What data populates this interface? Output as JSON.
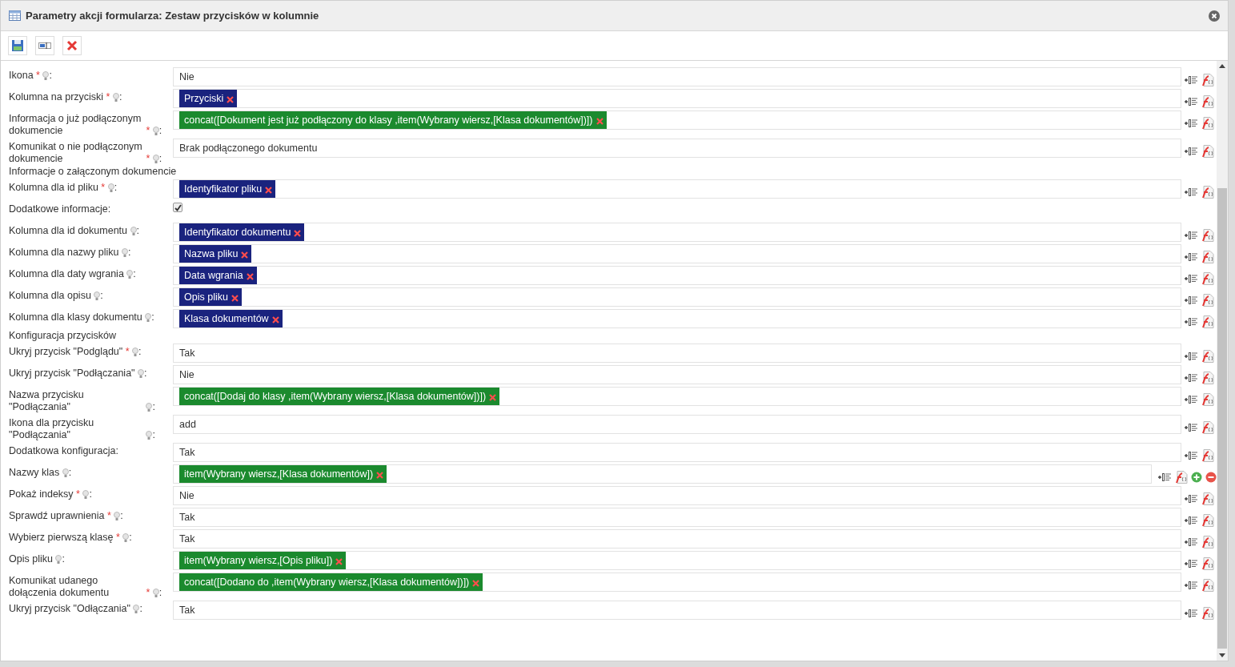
{
  "window": {
    "title": "Parametry akcji formularza: Zestaw przycisków w kolumnie"
  },
  "rows": [
    {
      "kind": "field",
      "label": "Ikona",
      "star": "*",
      "hint": true,
      "colon": ":",
      "value": "Nie"
    },
    {
      "kind": "tag",
      "label": "Kolumna na przyciski",
      "star": "*",
      "hint": true,
      "colon": ":",
      "value": "Przyciski",
      "color": "#1a237e"
    },
    {
      "kind": "tag",
      "label": "Informacja o już podłączonym dokumencie",
      "star": "*",
      "hint": true,
      "colon": ":",
      "value": "concat([Dokument jest już podłączony do klasy ,item(Wybrany wiersz,[Klasa dokumentów])])",
      "color": "#1b8a2e"
    },
    {
      "kind": "field",
      "label": "Komunikat o nie podłączonym dokumencie",
      "star": "*",
      "hint": true,
      "colon": ":",
      "value": "Brak podłączonego dokumentu"
    },
    {
      "kind": "section",
      "label": "Informacje o załączonym dokumencie"
    },
    {
      "kind": "tag",
      "label": "Kolumna dla id pliku",
      "star": "*",
      "hint": true,
      "colon": ":",
      "value": "Identyfikator pliku",
      "color": "#1a237e"
    },
    {
      "kind": "checkbox",
      "label": "Dodatkowe informacje",
      "colon": ":",
      "checked": true
    },
    {
      "kind": "tag",
      "label": "Kolumna dla id dokumentu",
      "hint": true,
      "colon": ":",
      "value": "Identyfikator dokumentu",
      "color": "#1a237e"
    },
    {
      "kind": "tag",
      "label": "Kolumna dla nazwy pliku",
      "hint": true,
      "colon": ":",
      "value": "Nazwa pliku",
      "color": "#1a237e"
    },
    {
      "kind": "tag",
      "label": "Kolumna dla daty wgrania",
      "hint": true,
      "colon": ":",
      "value": "Data wgrania",
      "color": "#1a237e"
    },
    {
      "kind": "tag",
      "label": "Kolumna dla opisu",
      "hint": true,
      "colon": ":",
      "value": "Opis pliku",
      "color": "#1a237e"
    },
    {
      "kind": "tag",
      "label": "Kolumna dla klasy dokumentu",
      "hint": true,
      "colon": ":",
      "value": "Klasa dokumentów",
      "color": "#1a237e"
    },
    {
      "kind": "section",
      "label": "Konfiguracja przycisków"
    },
    {
      "kind": "field",
      "label": "Ukryj przycisk \"Podglądu\"",
      "star": "*",
      "hint": true,
      "colon": ":",
      "value": "Tak"
    },
    {
      "kind": "field",
      "label": "Ukryj przycisk \"Podłączania\"",
      "hint": true,
      "colon": ":",
      "value": "Nie"
    },
    {
      "kind": "tag",
      "label": "Nazwa przycisku \"Podłączania\"",
      "hint": true,
      "colon": ":",
      "value": "concat([Dodaj do klasy ,item(Wybrany wiersz,[Klasa dokumentów])])",
      "color": "#1b8a2e"
    },
    {
      "kind": "field",
      "label": "Ikona dla przycisku \"Podłączania\"",
      "hint": true,
      "colon": ":",
      "value": "add"
    },
    {
      "kind": "field",
      "label": "Dodatkowa konfiguracja",
      "colon": ":",
      "value": "Tak"
    },
    {
      "kind": "tag",
      "label": "Nazwy klas",
      "hint": true,
      "colon": ":",
      "value": "item(Wybrany wiersz,[Klasa dokumentów])",
      "color": "#1b8a2e",
      "multi": true
    },
    {
      "kind": "field",
      "label": "Pokaż indeksy",
      "star": "*",
      "hint": true,
      "colon": ":",
      "value": "Nie"
    },
    {
      "kind": "field",
      "label": "Sprawdź uprawnienia",
      "star": "*",
      "hint": true,
      "colon": ":",
      "value": "Tak"
    },
    {
      "kind": "field",
      "label": "Wybierz pierwszą klasę",
      "star": "*",
      "hint": true,
      "colon": ":",
      "value": "Tak"
    },
    {
      "kind": "tag",
      "label": "Opis pliku",
      "hint": true,
      "colon": ":",
      "value": "item(Wybrany wiersz,[Opis pliku])",
      "color": "#1b8a2e"
    },
    {
      "kind": "tag",
      "label": "Komunikat udanego dołączenia dokumentu",
      "star": "*",
      "hint": true,
      "colon": ":",
      "value": "concat([Dodano do ,item(Wybrany wiersz,[Klasa dokumentów])])",
      "color": "#1b8a2e"
    },
    {
      "kind": "field",
      "label": "Ukryj przycisk \"Odłączania\"",
      "hint": true,
      "colon": ":",
      "value": "Tak"
    }
  ]
}
